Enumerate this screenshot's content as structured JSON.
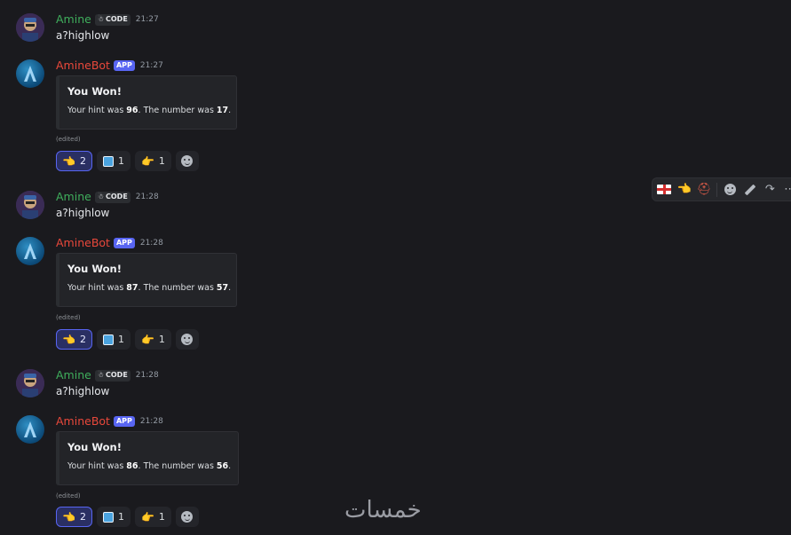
{
  "messages": [
    {
      "type": "user",
      "username": "Amine",
      "tag": "CODE",
      "time": "21:27",
      "text": "a?highlow"
    },
    {
      "type": "bot",
      "username": "AmineBot",
      "tag": "APP",
      "time": "21:27",
      "embed": {
        "title": "You Won!",
        "hint_prefix": "Your hint was ",
        "hint": "96",
        "mid": ". The number was ",
        "number": "17",
        "suffix": "."
      },
      "edited": "(edited)",
      "reactions": [
        {
          "icon": "point-left-emoji",
          "count": "2",
          "me": true
        },
        {
          "icon": "blue-square-emoji",
          "count": "1",
          "me": false
        },
        {
          "icon": "point-right-emoji",
          "count": "1",
          "me": false
        }
      ]
    },
    {
      "type": "user",
      "username": "Amine",
      "tag": "CODE",
      "time": "21:28",
      "text": "a?highlow"
    },
    {
      "type": "bot",
      "username": "AmineBot",
      "tag": "APP",
      "time": "21:28",
      "embed": {
        "title": "You Won!",
        "hint_prefix": "Your hint was ",
        "hint": "87",
        "mid": ". The number was ",
        "number": "57",
        "suffix": "."
      },
      "edited": "(edited)",
      "reactions": [
        {
          "icon": "point-left-emoji",
          "count": "2",
          "me": true
        },
        {
          "icon": "blue-square-emoji",
          "count": "1",
          "me": false
        },
        {
          "icon": "point-right-emoji",
          "count": "1",
          "me": false
        }
      ]
    },
    {
      "type": "user",
      "username": "Amine",
      "tag": "CODE",
      "time": "21:28",
      "text": "a?highlow"
    },
    {
      "type": "bot",
      "username": "AmineBot",
      "tag": "APP",
      "time": "21:28",
      "embed": {
        "title": "You Won!",
        "hint_prefix": "Your hint was ",
        "hint": "86",
        "mid": ". The number was ",
        "number": "56",
        "suffix": "."
      },
      "edited": "(edited)",
      "reactions": [
        {
          "icon": "point-left-emoji",
          "count": "2",
          "me": true
        },
        {
          "icon": "blue-square-emoji",
          "count": "1",
          "me": false
        },
        {
          "icon": "point-right-emoji",
          "count": "1",
          "me": false
        }
      ]
    }
  ],
  "toolbar": {
    "items": [
      "england-flag-emoji",
      "point-left-emoji",
      "fire-helmet-emoji",
      "add-reaction-icon",
      "edit-icon",
      "forward-icon",
      "more-icon"
    ]
  },
  "watermark": "خمسات",
  "colors": {
    "user_name": "#3fae5c",
    "bot_name": "#e8483b",
    "app_badge": "#5865f2",
    "background": "#1a1a1e"
  }
}
